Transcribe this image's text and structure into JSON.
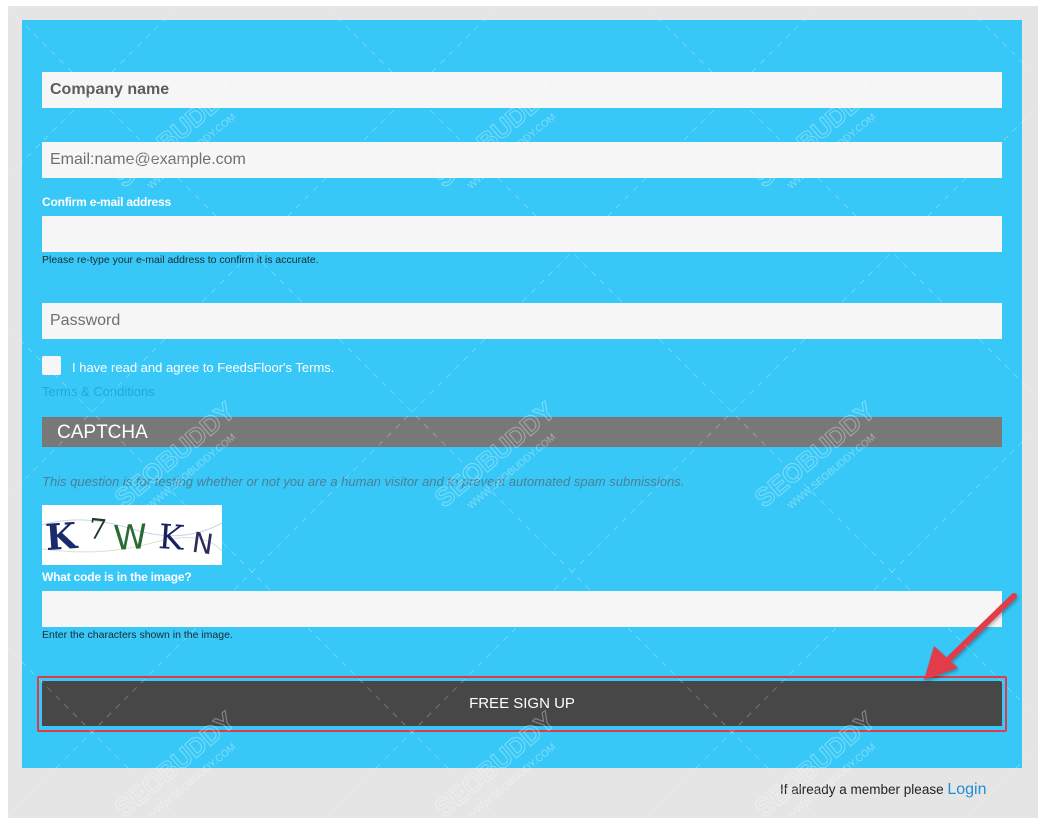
{
  "form": {
    "company_placeholder": "Company name",
    "email_placeholder": "Email:name@example.com",
    "confirm_label": "Confirm e-mail address",
    "confirm_help": "Please re-type your e-mail address to confirm it is accurate.",
    "password_placeholder": "Password",
    "agree_text": "I have read and agree to FeedsFloor's Terms.",
    "terms_link": "Terms & Conditions"
  },
  "captcha": {
    "title": "CAPTCHA",
    "description": "This question is for testing whether or not you are a human visitor and to prevent automated spam submissions.",
    "image_text": "K7WKN",
    "code_label": "What code is in the image?",
    "code_help": "Enter the characters shown in the image."
  },
  "submit": {
    "label": "FREE SIGN UP"
  },
  "footer": {
    "member_text": "If already a member please ",
    "login_label": "Login"
  },
  "watermark": {
    "brand": "SEOBUDDY",
    "site": "WWW.SEOBUDDY.COM"
  },
  "colors": {
    "panel": "#37c8f7",
    "button": "#474747",
    "highlight": "#e23b48",
    "link": "#1f8fd6"
  }
}
